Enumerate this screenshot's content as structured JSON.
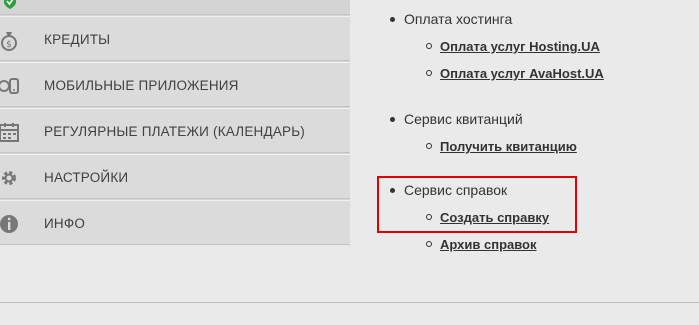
{
  "menu": {
    "items": [
      {
        "label": "КРЕДИТЫ",
        "icon": "money-bag-icon"
      },
      {
        "label": "МОБИЛЬНЫЕ ПРИЛОЖЕНИЯ",
        "icon": "mobile-apps-icon"
      },
      {
        "label": "РЕГУЛЯРНЫЕ ПЛАТЕЖИ (КАЛЕНДАРЬ)",
        "icon": "calendar-icon"
      },
      {
        "label": "НАСТРОЙКИ",
        "icon": "gear-icon"
      },
      {
        "label": "ИНФО",
        "icon": "info-icon"
      }
    ]
  },
  "content": {
    "sections": [
      {
        "title": "Оплата хостинга",
        "links": [
          "Оплата услуг Hosting.UA",
          "Оплата услуг AvaHost.UA"
        ]
      },
      {
        "title": "Сервис квитанций",
        "links": [
          "Получить квитанцию"
        ]
      },
      {
        "title": "Сервис справок",
        "links": [
          "Создать справку",
          "Архив справок"
        ]
      }
    ]
  },
  "colors": {
    "highlight": "#e00000",
    "shield": "#2e9e3f"
  }
}
